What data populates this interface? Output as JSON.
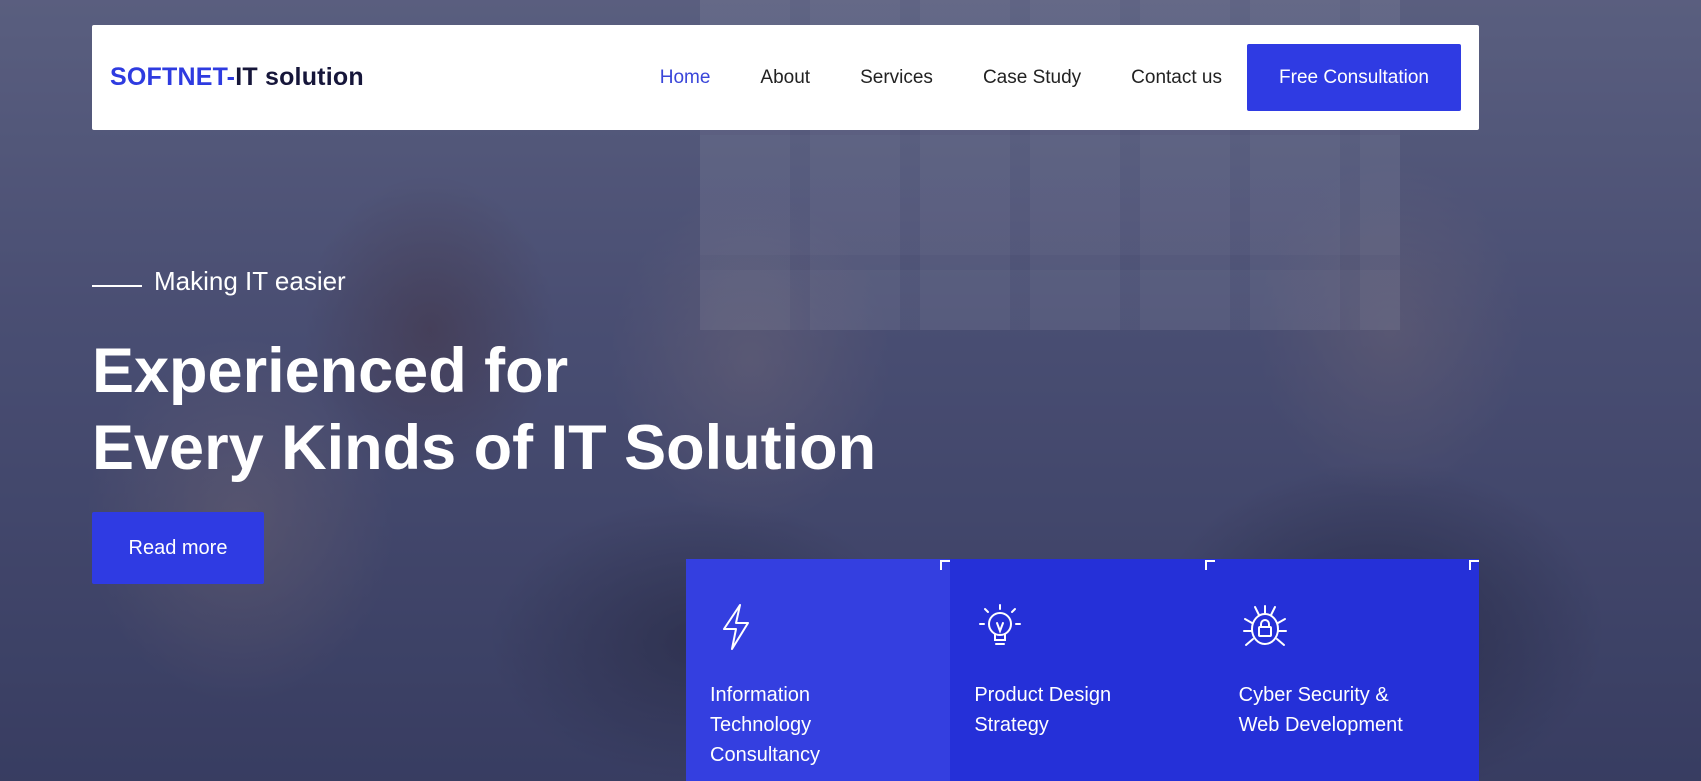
{
  "header": {
    "logo_brand": "SOFTNET-",
    "logo_rest": "IT solution",
    "nav": [
      {
        "label": "Home",
        "active": true
      },
      {
        "label": "About"
      },
      {
        "label": "Services"
      },
      {
        "label": "Case Study"
      },
      {
        "label": "Contact us"
      }
    ],
    "cta_label": "Free Consultation"
  },
  "hero": {
    "tagline": "Making IT easier",
    "headline_line1": "Experienced for",
    "headline_line2": "Every Kinds of IT Solution",
    "read_more_label": "Read more"
  },
  "cards": [
    {
      "icon": "lightning-icon",
      "title_line1": "Information",
      "title_line2": "Technology",
      "title_line3": "Consultancy"
    },
    {
      "icon": "lightbulb-icon",
      "title_line1": "Product Design",
      "title_line2": "Strategy"
    },
    {
      "icon": "security-bug-lock-icon",
      "title_line1": "Cyber Security &",
      "title_line2": "Web Development"
    }
  ],
  "colors": {
    "accent": "#2f3be3",
    "card_bg": "#2530d8",
    "nav_active": "#3a46d9"
  }
}
